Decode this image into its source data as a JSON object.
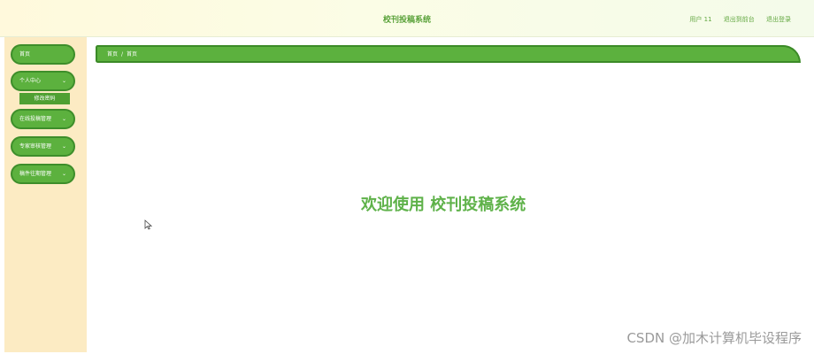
{
  "header": {
    "title": "校刊投稿系统",
    "user_label": "用户 11",
    "back_label": "退出到前台",
    "logout_label": "退出登录"
  },
  "sidebar": {
    "items": [
      {
        "label": "首页",
        "has_submenu": false
      },
      {
        "label": "个人中心",
        "has_submenu": true,
        "expanded": true
      },
      {
        "label": "在线投稿管理",
        "has_submenu": true
      },
      {
        "label": "专家审核管理",
        "has_submenu": true
      },
      {
        "label": "稿件往期管理",
        "has_submenu": true
      }
    ],
    "submenu": {
      "label": "修改密码"
    }
  },
  "breadcrumb": {
    "items": [
      "首页",
      "首页"
    ],
    "separator": "/"
  },
  "main": {
    "welcome_text": "欢迎使用 校刊投稿系统"
  },
  "watermark": {
    "text": "CSDN @加木计算机毕设程序"
  },
  "colors": {
    "accent_green": "#5cb13e",
    "sidebar_bg": "#fcebc3",
    "title_green": "#5aa23a"
  },
  "icons": {
    "chevron": "chevron-down-icon",
    "cursor": "mouse-pointer-icon"
  }
}
